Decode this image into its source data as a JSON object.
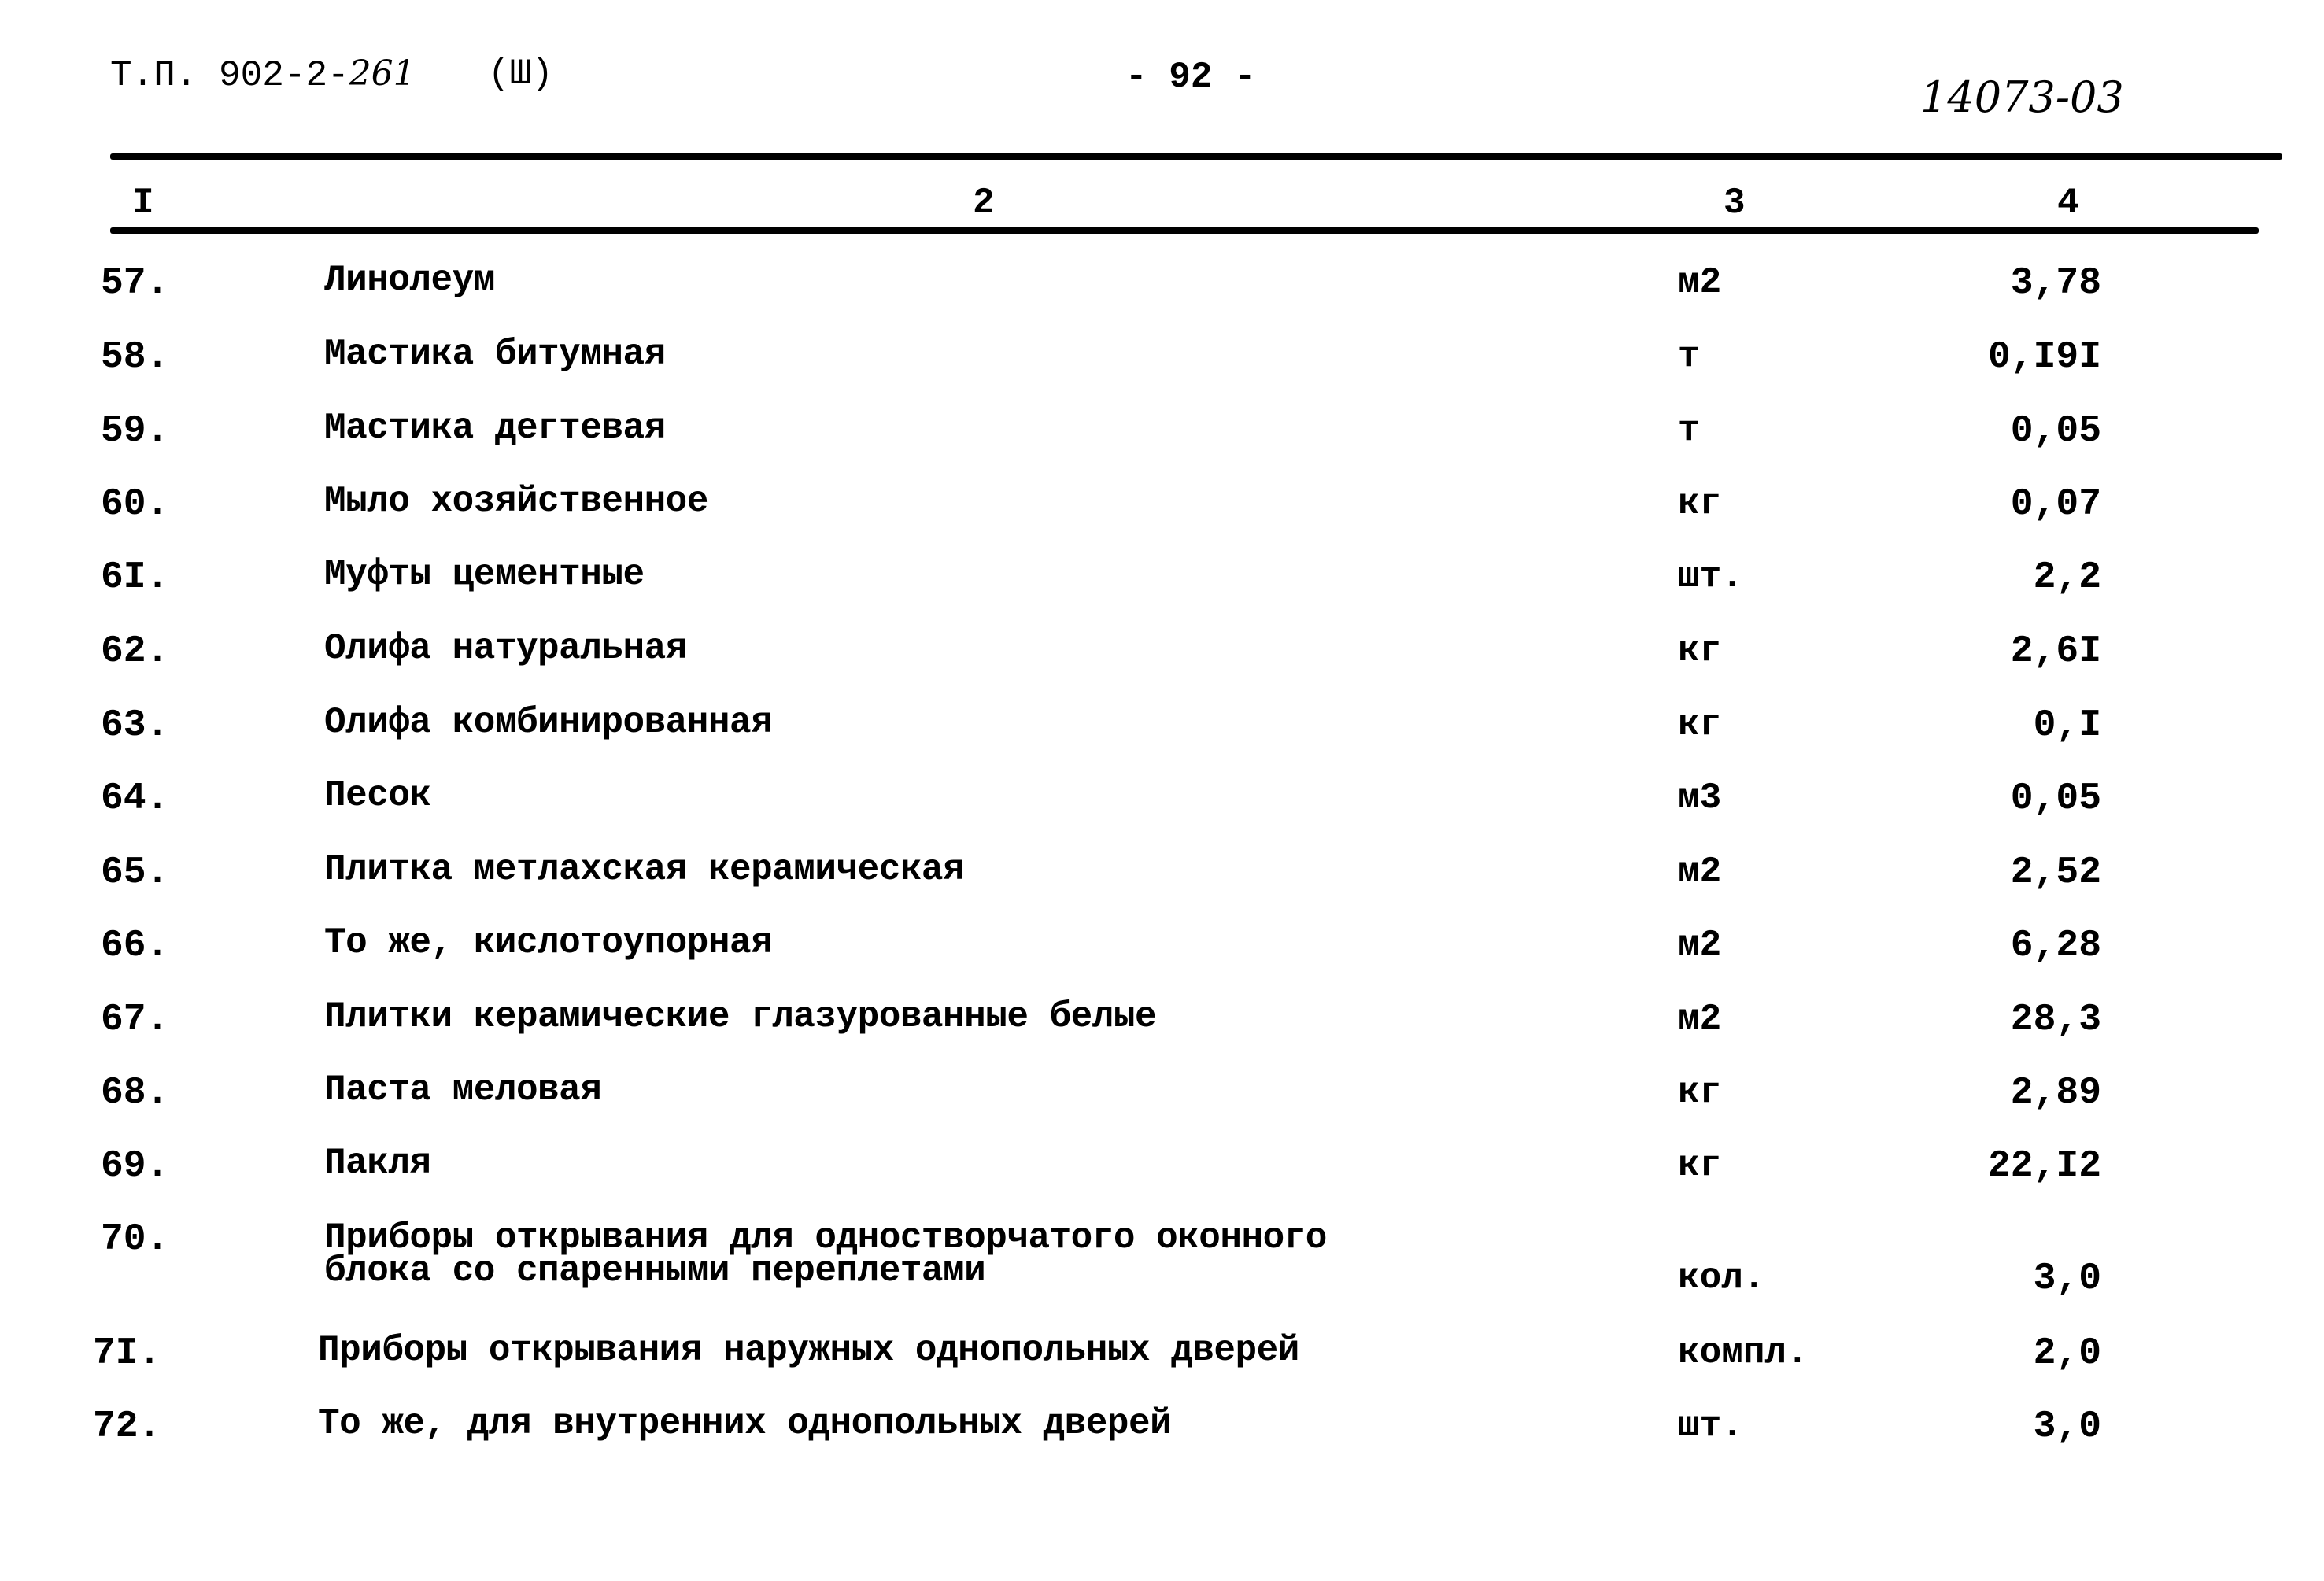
{
  "header": {
    "doc_code_printed": "Т.П. 902-2-",
    "doc_code_handwritten": "261",
    "volume": "(Ш)",
    "page_number": "- 92 -",
    "inventory_number": "14073-03"
  },
  "table": {
    "column_numbers": [
      "I",
      "2",
      "3",
      "4"
    ],
    "rows": [
      {
        "n": "57.",
        "name": "Линолеум",
        "unit": "м2",
        "qty": "3,78"
      },
      {
        "n": "58.",
        "name": "Мастика битумная",
        "unit": "т",
        "qty": "0,I9I"
      },
      {
        "n": "59.",
        "name": "Мастика дегтевая",
        "unit": "т",
        "qty": "0,05"
      },
      {
        "n": "60.",
        "name": "Мыло хозяйственное",
        "unit": "кг",
        "qty": "0,07"
      },
      {
        "n": "6I.",
        "name": "Муфты цементные",
        "unit": "шт.",
        "qty": "2,2"
      },
      {
        "n": "62.",
        "name": "Олифа натуральная",
        "unit": "кг",
        "qty": "2,6I"
      },
      {
        "n": "63.",
        "name": "Олифа комбинированная",
        "unit": "кг",
        "qty": "0,I"
      },
      {
        "n": "64.",
        "name": "Песок",
        "unit": "м3",
        "qty": "0,05"
      },
      {
        "n": "65.",
        "name": "Плитка метлахская керамическая",
        "unit": "м2",
        "qty": "2,52"
      },
      {
        "n": "66.",
        "name": "То же, кислотоупорная",
        "unit": "м2",
        "qty": "6,28"
      },
      {
        "n": "67.",
        "name": "Плитки керамические глазурованные белые",
        "unit": "м2",
        "qty": "28,3"
      },
      {
        "n": "68.",
        "name": "Паста меловая",
        "unit": "кг",
        "qty": "2,89"
      },
      {
        "n": "69.",
        "name": "Пакля",
        "unit": "кг",
        "qty": "22,I2"
      },
      {
        "n": "70.",
        "name": "Приборы открывания для одностворчатого оконного",
        "name_line2": "блока со спаренными переплетами",
        "unit": "кол.",
        "qty": "3,0"
      },
      {
        "n": "7I.",
        "name": "Приборы открывания наружных однопольных дверей",
        "unit": "компл.",
        "qty": "2,0"
      },
      {
        "n": "72.",
        "name": "То же, для внутренних однопольных дверей",
        "unit": "шт.",
        "qty": "3,0"
      }
    ]
  }
}
